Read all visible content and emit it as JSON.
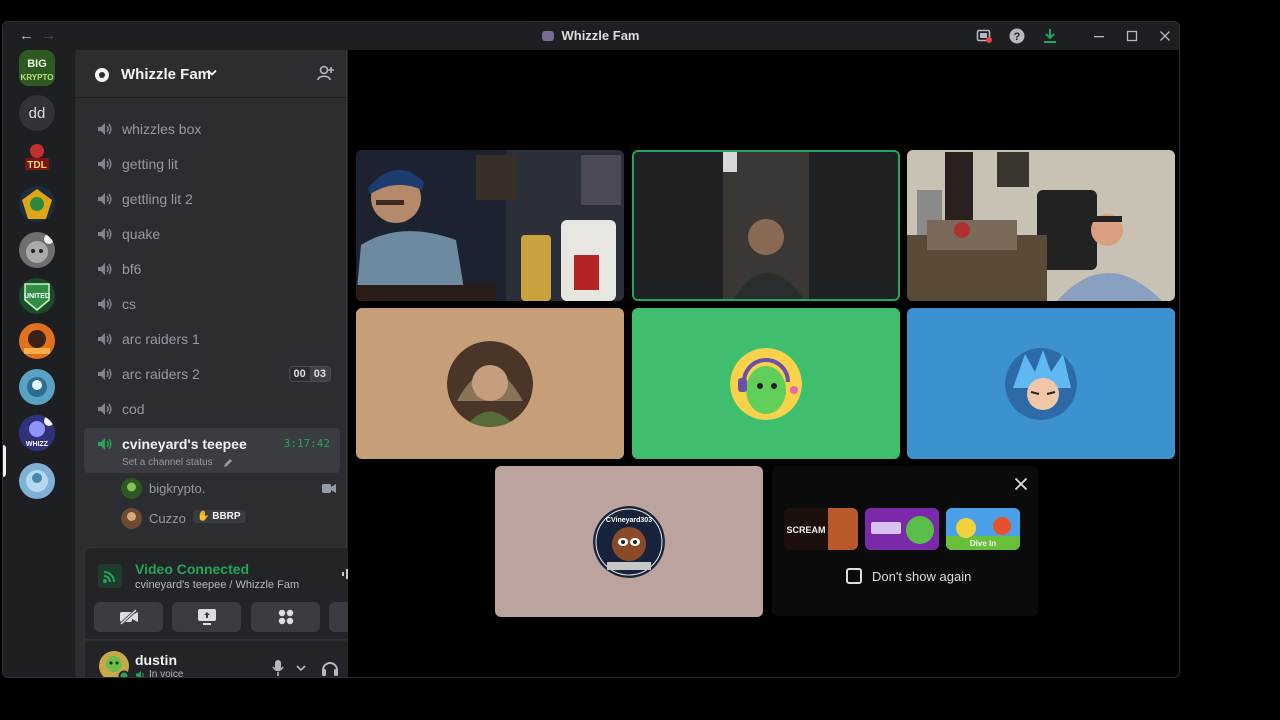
{
  "window": {
    "title": "Whizzle Fam",
    "back_icon": "←",
    "forward_icon": "→",
    "titlebar_icons": [
      "inbox-icon",
      "help-icon",
      "download-icon"
    ],
    "controls": [
      "minimize",
      "maximize",
      "close"
    ]
  },
  "rail": {
    "dm_label": "dd",
    "servers": [
      "BIG KRYPTO",
      "dd",
      "TDL",
      "server",
      "server",
      "UNITED",
      "server",
      "server",
      "server",
      "server"
    ]
  },
  "server": {
    "name": "Whizzle Fam",
    "channels": [
      {
        "label": "whizzles box"
      },
      {
        "label": "getting lit"
      },
      {
        "label": "gettling lit 2"
      },
      {
        "label": "quake"
      },
      {
        "label": "bf6"
      },
      {
        "label": "cs"
      },
      {
        "label": "arc raiders 1"
      },
      {
        "label": "arc raiders 2",
        "badge": [
          "00",
          "03"
        ]
      },
      {
        "label": "cod"
      }
    ],
    "active_channel": {
      "label": "cvineyard's teepee",
      "timer": "3:17:42",
      "status_placeholder": "Set a channel status",
      "members": [
        {
          "name": "bigkrypto."
        },
        {
          "name": "Cuzzo",
          "tag": "BBRP"
        }
      ]
    }
  },
  "voice": {
    "status": "Video Connected",
    "location": "cvineyard's teepee / Whizzle Fam",
    "accent": "#23a55a"
  },
  "user": {
    "name": "dustin",
    "status": "In voice"
  },
  "promo": {
    "dont_show": "Don't show again",
    "thumb_1": "SCREAM",
    "thumb_3": "Dive In"
  },
  "avatars": {
    "tile_5_name": "CVineyard303"
  }
}
